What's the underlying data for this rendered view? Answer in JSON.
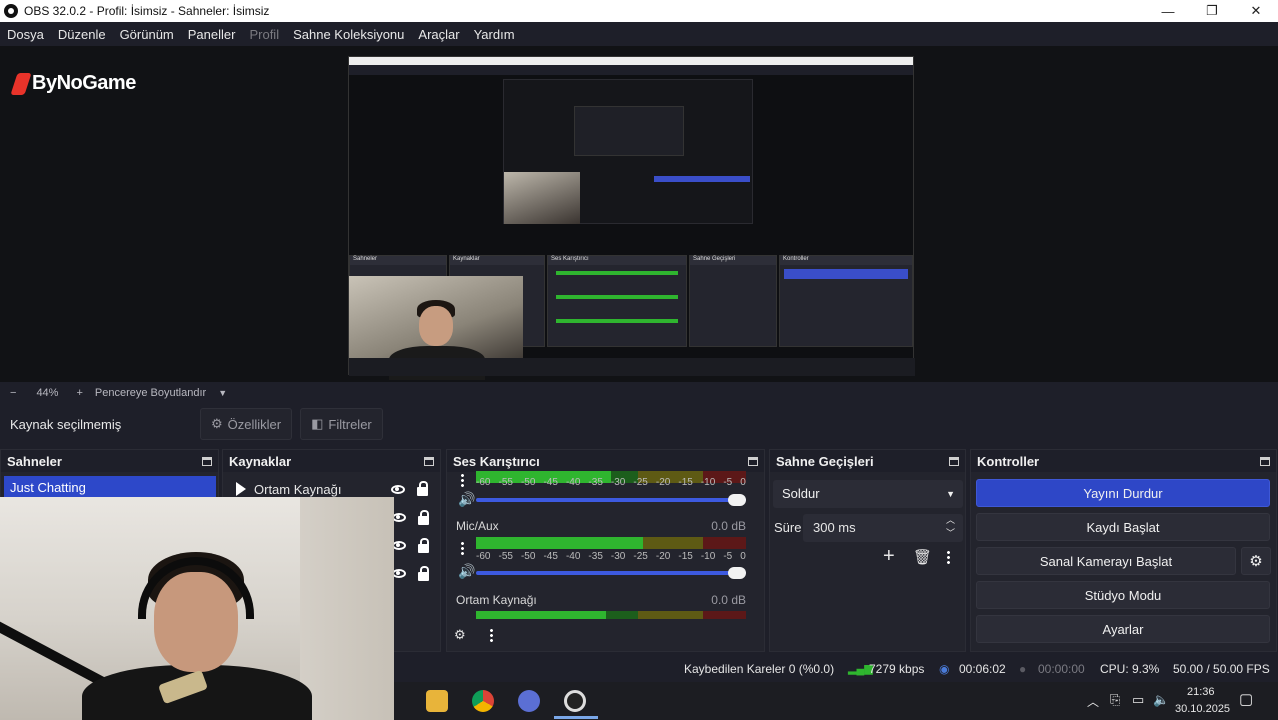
{
  "window": {
    "title": "OBS 32.0.2 - Profil: İsimsiz - Sahneler: İsimsiz",
    "minimize": "—",
    "restore": "❐",
    "close": "✕"
  },
  "menu": {
    "items": [
      "Dosya",
      "Düzenle",
      "Görünüm",
      "Paneller",
      "Profil",
      "Sahne Koleksiyonu",
      "Araçlar",
      "Yardım"
    ],
    "disabled": [
      "Profil"
    ]
  },
  "preview": {
    "brand": "ByNoGame"
  },
  "zoom": {
    "minus": "−",
    "value": "44%",
    "plus": "+",
    "mode": "Pencereye Boyutlandır"
  },
  "source_bar": {
    "status": "Kaynak seçilmemiş",
    "properties": "Özellikler",
    "filters": "Filtreler"
  },
  "scenes": {
    "title": "Sahneler",
    "items": [
      "Just Chatting"
    ]
  },
  "sources": {
    "title": "Kaynaklar",
    "items": [
      "Ortam Kaynağı"
    ]
  },
  "mixer": {
    "title": "Ses Karıştırıcı",
    "ticks": [
      "-60",
      "-55",
      "-50",
      "-45",
      "-40",
      "-35",
      "-30",
      "-25",
      "-20",
      "-15",
      "-10",
      "-5",
      "0"
    ],
    "channels": [
      {
        "name": "Mic/Aux",
        "db": "0.0 dB",
        "level": 0.62
      },
      {
        "name": "Ortam Kaynağı",
        "db": "0.0 dB",
        "level": 0.48
      }
    ],
    "top_level": 0.5
  },
  "transitions": {
    "title": "Sahne Geçişleri",
    "selected": "Soldur",
    "duration_label": "Süre",
    "duration_value": "300 ms"
  },
  "controls": {
    "title": "Kontroller",
    "stop_stream": "Yayını Durdur",
    "start_record": "Kaydı Başlat",
    "start_virtualcam": "Sanal Kamerayı Başlat",
    "studio_mode": "Stüdyo Modu",
    "settings": "Ayarlar"
  },
  "status": {
    "dropped_frames": "Kaybedilen Kareler 0 (%0.0)",
    "bitrate": "7279 kbps",
    "stream_time": "00:06:02",
    "record_time": "00:00:00",
    "cpu": "CPU: 9.3%",
    "fps": "50.00 / 50.00 FPS"
  },
  "taskbar": {
    "time": "21:36",
    "date": "30.10.2025"
  },
  "colors": {
    "accent": "#2e47c7",
    "bg": "#1e1f29",
    "dock": "#23242d",
    "live_green": "#2fb52f"
  }
}
